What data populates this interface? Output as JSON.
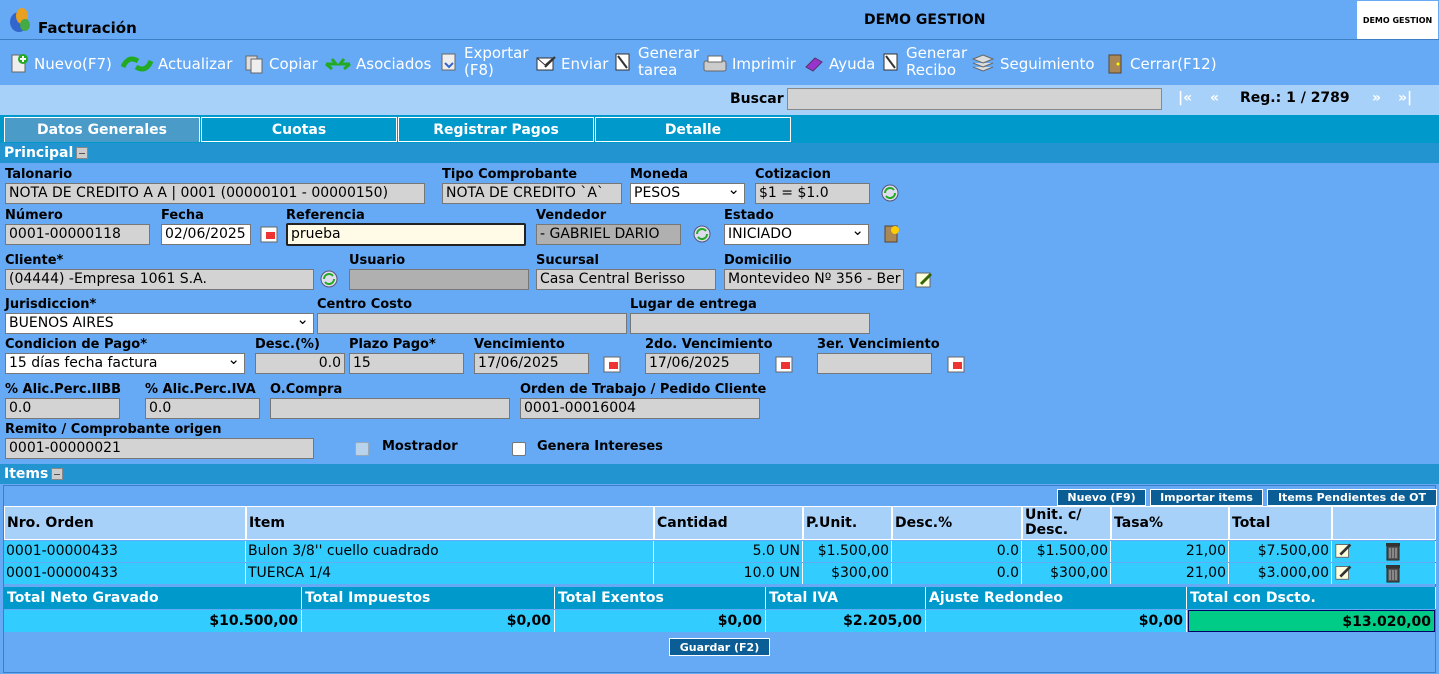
{
  "app": {
    "title": "Facturación",
    "center_title": "DEMO GESTION",
    "logo_text": "DEMO GESTION"
  },
  "toolbar": {
    "nuevo": "Nuevo(F7)",
    "actualizar": "Actualizar",
    "copiar": "Copiar",
    "asociados": "Asociados",
    "exportar_1": "Exportar",
    "exportar_2": "(F8)",
    "enviar": "Enviar",
    "tarea_1": "Generar",
    "tarea_2": "tarea",
    "imprimir": "Imprimir",
    "ayuda": "Ayuda",
    "recibo_1": "Generar",
    "recibo_2": "Recibo",
    "seguimiento": "Seguimiento",
    "cerrar": "Cerrar(F12)"
  },
  "search": {
    "label": "Buscar",
    "value": "",
    "first": "|«",
    "prev": "«",
    "reg": "Reg.: 1 / 2789",
    "next": "»",
    "last": "»|"
  },
  "tabs": [
    "Datos Generales",
    "Cuotas",
    "Registrar Pagos",
    "Detalle"
  ],
  "principal": {
    "title": "Principal",
    "talonario_lbl": "Talonario",
    "talonario": "NOTA DE CREDITO A A | 0001 (00000101 - 00000150)",
    "tipo_lbl": "Tipo Comprobante",
    "tipo": "NOTA DE CREDITO `A`",
    "moneda_lbl": "Moneda",
    "moneda": "PESOS",
    "cotiz_lbl": "Cotizacion",
    "cotiz": "$1 = $1.0",
    "numero_lbl": "Número",
    "numero": "0001-00000118",
    "fecha_lbl": "Fecha",
    "fecha": "02/06/2025",
    "ref_lbl": "Referencia",
    "ref": "prueba",
    "vendedor_lbl": "Vendedor",
    "vendedor": "- GABRIEL DARIO",
    "estado_lbl": "Estado",
    "estado": "INICIADO",
    "cliente_lbl": "Cliente*",
    "cliente": "(04444) -Empresa 1061 S.A.",
    "usuario_lbl": "Usuario",
    "usuario": "",
    "sucursal_lbl": "Sucursal",
    "sucursal": "Casa Central Berisso",
    "domicilio_lbl": "Domicilio",
    "domicilio": "Montevideo Nº 356 - Ber",
    "jur_lbl": "Jurisdiccion*",
    "jur": "BUENOS AIRES",
    "cc_lbl": "Centro Costo",
    "cc": "",
    "lugar_lbl": "Lugar de entrega",
    "lugar": "",
    "cond_lbl": "Condicion de Pago*",
    "cond": "15 días fecha factura",
    "desc_lbl": "Desc.(%)",
    "desc": "0.0",
    "plazo_lbl": "Plazo Pago*",
    "plazo": "15",
    "venc_lbl": "Vencimiento",
    "venc": "17/06/2025",
    "venc2_lbl": "2do. Vencimiento",
    "venc2": "17/06/2025",
    "venc3_lbl": "3er. Vencimiento",
    "venc3": "",
    "iibb_lbl": "% Alic.Perc.IIBB",
    "iibb": "0.0",
    "iva_lbl": "% Alic.Perc.IVA",
    "iva": "0.0",
    "oc_lbl": "O.Compra",
    "oc": "",
    "ot_lbl": "Orden de Trabajo / Pedido Cliente",
    "ot": "0001-00016004",
    "remito_lbl": "Remito / Comprobante origen",
    "remito": "0001-00000021",
    "mostrador_lbl": "Mostrador",
    "intereses_lbl": "Genera Intereses"
  },
  "items": {
    "title": "Items",
    "btn_nuevo": "Nuevo (F9)",
    "btn_importar": "Importar items",
    "btn_pend": "Items Pendientes de OT",
    "cols": [
      "Nro. Orden",
      "Item",
      "Cantidad",
      "P.Unit.",
      "Desc.%",
      "Unit. c/ Desc.",
      "Tasa%",
      "Total"
    ],
    "rows": [
      [
        "0001-00000433",
        "Bulon 3/8'' cuello cuadrado",
        "5.0 UN",
        "$1.500,00",
        "0.0",
        "$1.500,00",
        "21,00",
        "$7.500,00"
      ],
      [
        "0001-00000433",
        "TUERCA 1/4",
        "10.0 UN",
        "$300,00",
        "0.0",
        "$300,00",
        "21,00",
        "$3.000,00"
      ]
    ]
  },
  "totals": {
    "labels": [
      "Total Neto Gravado",
      "Total Impuestos",
      "Total Exentos",
      "Total IVA",
      "Ajuste Redondeo",
      "Total con Dscto."
    ],
    "values": [
      "$10.500,00",
      "$0,00",
      "$0,00",
      "$2.205,00",
      "$0,00",
      "$13.020,00"
    ]
  },
  "save": "Guardar (F2)"
}
